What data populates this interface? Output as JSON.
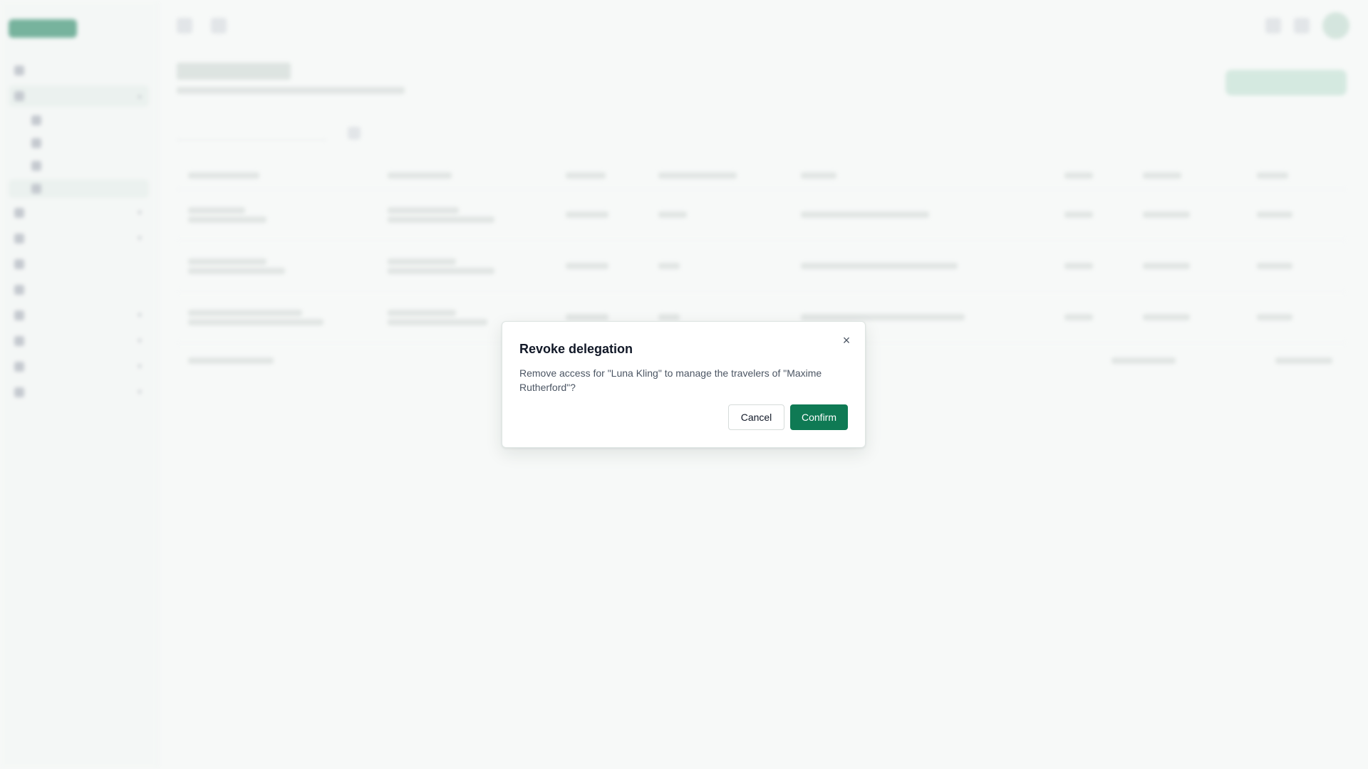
{
  "dialog": {
    "title": "Revoke delegation",
    "close_icon": "close-icon",
    "close_glyph": "×",
    "message": "Remove access for \"Luna Kling\" to manage the travelers of \"Maxime Rutherford\"?",
    "cancel_label": "Cancel",
    "confirm_label": "Confirm"
  },
  "colors": {
    "accent": "#0f7a54",
    "background": "#f7f9f8",
    "modal_border": "#dfe6e3"
  }
}
